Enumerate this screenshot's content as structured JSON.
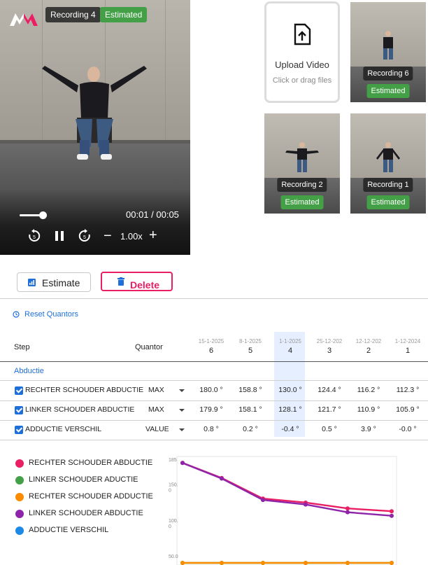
{
  "player": {
    "recording_label": "Recording 4",
    "status_label": "Estimated",
    "time_display": "00:01 / 00:05",
    "speed": "1.00x",
    "progress": 0.2
  },
  "upload": {
    "title": "Upload Video",
    "subtitle": "Click or drag files"
  },
  "recordings": [
    {
      "label": "Recording 6",
      "status": "Estimated"
    },
    {
      "label": "Recording 2",
      "status": "Estimated"
    },
    {
      "label": "Recording 1",
      "status": "Estimated"
    }
  ],
  "actions": {
    "estimate_label": "Estimate",
    "delete_label": "Delete"
  },
  "reset_label": "Reset Quantors",
  "table": {
    "header_step": "Step",
    "header_quantor": "Quantor",
    "columns": [
      {
        "date": "15-1-2025",
        "num": "6"
      },
      {
        "date": "8-1-2025",
        "num": "5"
      },
      {
        "date": "1-1-2025",
        "num": "4"
      },
      {
        "date": "25-12-202",
        "num": "3"
      },
      {
        "date": "12-12-202",
        "num": "2"
      },
      {
        "date": "1-12-2024",
        "num": "1"
      }
    ],
    "group_label": "Abductie",
    "rows": [
      {
        "label": "RECHTER SCHOUDER ABDUCTIE",
        "quantor": "MAX",
        "values": [
          "180.0 °",
          "158.8 °",
          "130.0 °",
          "124.4 °",
          "116.2 °",
          "112.3 °"
        ]
      },
      {
        "label": "LINKER SCHOUDER ABDUCTIE",
        "quantor": "MAX",
        "values": [
          "179.9 °",
          "158.1 °",
          "128.1 °",
          "121.7 °",
          "110.9 °",
          "105.9 °"
        ]
      },
      {
        "label": "ADDUCTIE VERSCHIL",
        "quantor": "VALUE",
        "values": [
          "0.8 °",
          "0.2 °",
          "-0.4 °",
          "0.5 °",
          "3.9 °",
          "-0.0 °"
        ]
      }
    ]
  },
  "legend": [
    {
      "label": "RECHTER SCHOUDER ABDUCTIE",
      "color": "#e91e63"
    },
    {
      "label": "LINKER SCHOUDER ADUCTIE",
      "color": "#43a047"
    },
    {
      "label": "RECHTER SCHOUDER ADDUCTIE",
      "color": "#fb8c00"
    },
    {
      "label": "LINKER SCHOUDER ABDUCTIE",
      "color": "#8e24aa"
    },
    {
      "label": "ADDUCTIE VERSCHIL",
      "color": "#1e88e5"
    }
  ],
  "chart_data": {
    "type": "line",
    "ylim": [
      40,
      185
    ],
    "y_ticks": [
      "185",
      "150.\n0",
      "100.\n0",
      "50.0"
    ],
    "y_tick_values": [
      185,
      150,
      100,
      50
    ],
    "series": [
      {
        "name": "RECHTER SCHOUDER ABDUCTIE",
        "color": "#e91e63",
        "values": [
          180.0,
          158.8,
          130.0,
          124.4,
          116.2,
          112.3
        ]
      },
      {
        "name": "LINKER SCHOUDER ABDUCTIE",
        "color": "#8e24aa",
        "values": [
          179.9,
          158.1,
          128.1,
          121.7,
          110.9,
          105.9
        ]
      },
      {
        "name": "LINKER SCHOUDER ADUCTIE",
        "color": "#43a047",
        "values": [
          0.8,
          0.2,
          -0.4,
          0.5,
          3.9,
          -0.0
        ]
      },
      {
        "name": "RECHTER SCHOUDER ADDUCTIE",
        "color": "#fb8c00",
        "values": [
          0.8,
          0.2,
          -0.4,
          0.5,
          3.9,
          -0.0
        ]
      }
    ]
  }
}
